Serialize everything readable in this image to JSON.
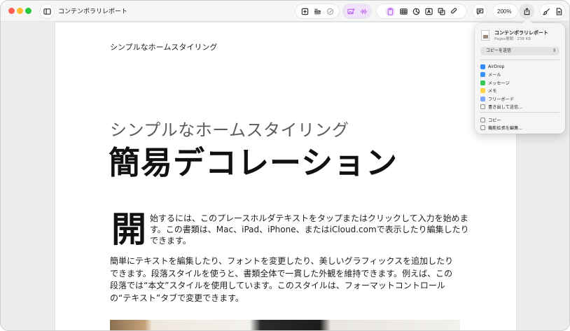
{
  "window": {
    "title": "コンテンポラリレポート",
    "zoom": "200%"
  },
  "document": {
    "header": "シンプルなホームスタイリング",
    "subtitle": "シンプルなホームスタイリング",
    "title": "簡易デコレーション",
    "dropcap": "開",
    "paragraph1": "始するには、このプレースホルダテキストをタップまたはクリックして入力を始めます。この書類は、Mac、iPad、iPhone、またはiCloud.comで表示したり編集したりできます。",
    "paragraph2": "簡単にテキストを編集したり、フォントを変更したり、美しいグラフィックスを追加したりできます。段落スタイルを使うと、書類全体で一貫した外観を維持できます。例えば、この段落では“本文”スタイルを使用しています。このスタイルは、フォーマットコントロールの“テキスト”タブで変更できます。"
  },
  "share_popover": {
    "file_name": "コンテンポラリレポート",
    "file_meta": "Pages書類 · 238 KB",
    "send_select": "コピーを送信",
    "items": [
      {
        "label": "AirDrop",
        "icon": "airdrop-icon",
        "color": "#2f8cff"
      },
      {
        "label": "メール",
        "icon": "mail-icon",
        "color": "#3b8ff7"
      },
      {
        "label": "メッセージ",
        "icon": "messages-icon",
        "color": "#34c759"
      },
      {
        "label": "メモ",
        "icon": "notes-icon",
        "color": "#ffd23f"
      },
      {
        "label": "フリーボード",
        "icon": "freeform-icon",
        "color": "#7aa7ff"
      },
      {
        "label": "書き出して送信...",
        "icon": "export-icon",
        "color": "#8a8a8a"
      },
      {
        "label": "コピー",
        "icon": "copy-icon",
        "color": "#8a8a8a"
      },
      {
        "label": "機能拡張を編集...",
        "icon": "extensions-icon",
        "color": "#8a8a8a"
      }
    ]
  },
  "colors": {
    "accent_purple": "#c06cf0",
    "traffic_red": "#fe5f57",
    "traffic_yellow": "#febc2e",
    "traffic_green": "#28c840"
  }
}
